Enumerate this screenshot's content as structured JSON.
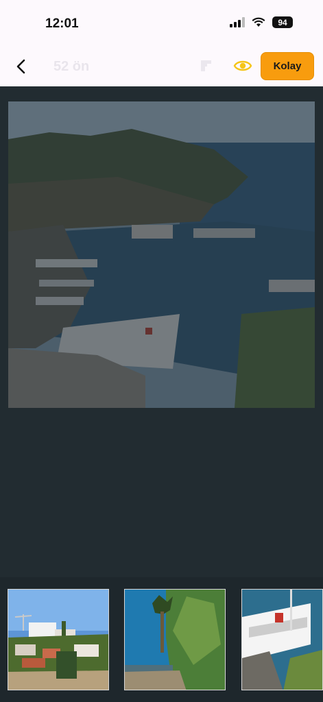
{
  "status_bar": {
    "time": "12:01",
    "battery": "94"
  },
  "header": {
    "title": "52 ön",
    "level_button": "Kolay"
  },
  "board": {
    "image": "antalya-harbor-photo"
  },
  "tray": {
    "pieces": [
      "piece-1",
      "piece-2",
      "piece-3"
    ]
  },
  "colors": {
    "accent": "#f89c0e",
    "background": "#222c31",
    "header_bg": "#fdf9fd",
    "eye": "#f5c518"
  }
}
